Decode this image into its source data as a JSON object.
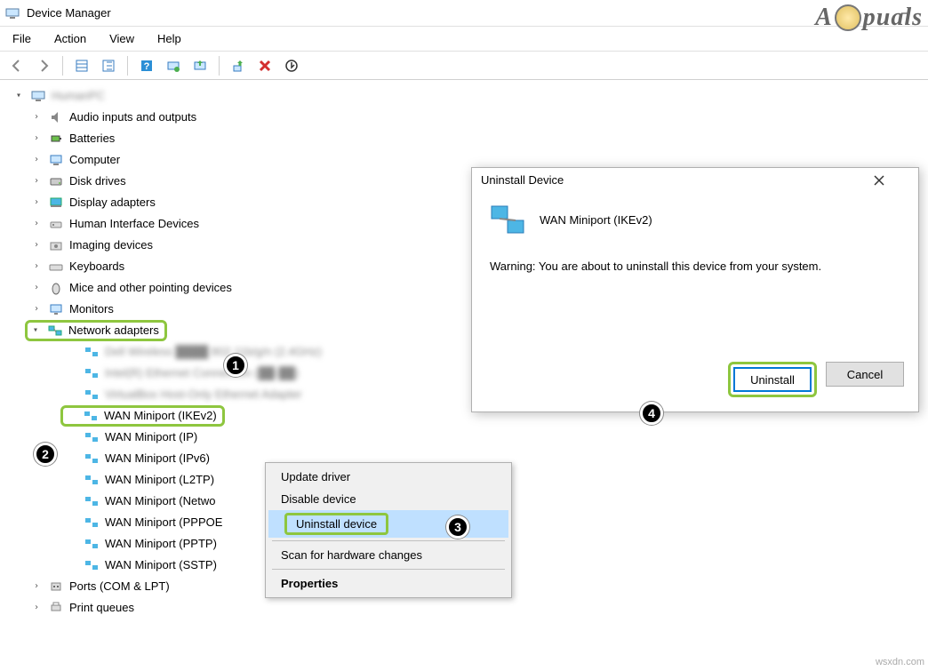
{
  "window": {
    "title": "Device Manager"
  },
  "menubar": [
    "File",
    "Action",
    "View",
    "Help"
  ],
  "tree": {
    "root_blur": "HumanPC",
    "categories": [
      "Audio inputs and outputs",
      "Batteries",
      "Computer",
      "Disk drives",
      "Display adapters",
      "Human Interface Devices",
      "Imaging devices",
      "Keyboards",
      "Mice and other pointing devices",
      "Monitors"
    ],
    "network_label": "Network adapters",
    "net_blur": [
      "Dell Wireless ████ 802.11b/g/n (2.4GHz)",
      "Intel(R) Ethernet Connection (██-██)",
      "VirtualBox Host-Only Ethernet Adapter"
    ],
    "wan": [
      "WAN Miniport (IKEv2)",
      "WAN Miniport (IP)",
      "WAN Miniport (IPv6)",
      "WAN Miniport (L2TP)",
      "WAN Miniport (Netwo",
      "WAN Miniport (PPPOE",
      "WAN Miniport (PPTP)",
      "WAN Miniport (SSTP)"
    ],
    "ports": "Ports (COM & LPT)",
    "print": "Print queues"
  },
  "context_menu": {
    "update": "Update driver",
    "disable": "Disable device",
    "uninstall": "Uninstall device",
    "scan": "Scan for hardware changes",
    "properties": "Properties"
  },
  "dialog": {
    "title": "Uninstall Device",
    "device": "WAN Miniport (IKEv2)",
    "warning": "Warning: You are about to uninstall this device from your system.",
    "uninstall_btn": "Uninstall",
    "cancel_btn": "Cancel"
  },
  "badges": {
    "b1": "1",
    "b2": "2",
    "b3": "3",
    "b4": "4"
  },
  "watermark": {
    "pre": "A",
    "post": "puals"
  },
  "source": "wsxdn.com"
}
